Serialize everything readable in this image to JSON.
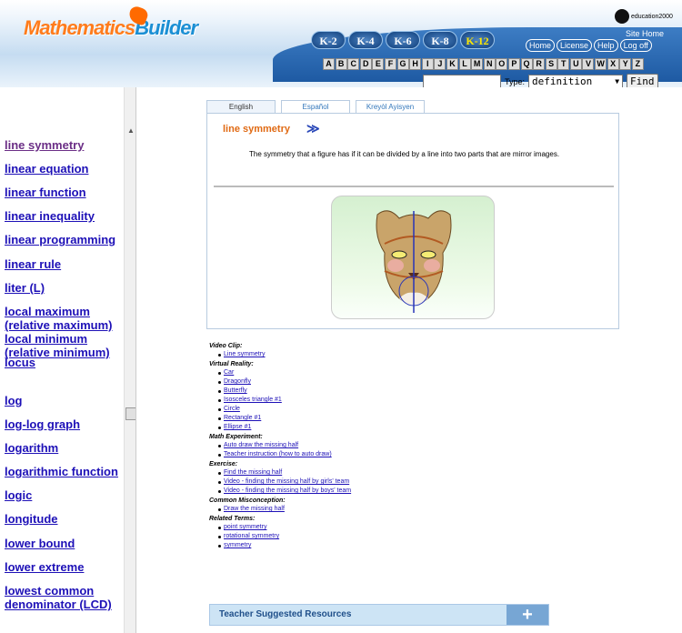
{
  "header": {
    "logo_left": "Mathematics",
    "logo_right": "Builder",
    "grades": [
      "K-2",
      "K-4",
      "K-6",
      "K-8",
      "K-12"
    ],
    "active_grade": "K-12",
    "brand": "education2000",
    "site_home": "Site Home",
    "top_links": [
      "Home",
      "License",
      "Help",
      "Log off"
    ]
  },
  "alphabet": [
    "A",
    "B",
    "C",
    "D",
    "E",
    "F",
    "G",
    "H",
    "I",
    "J",
    "K",
    "L",
    "M",
    "N",
    "O",
    "P",
    "Q",
    "R",
    "S",
    "T",
    "U",
    "V",
    "W",
    "X",
    "Y",
    "Z"
  ],
  "search": {
    "value": "",
    "type_label": "Type:",
    "type_value": "definition",
    "find_label": "Find"
  },
  "terms": [
    "line symmetry",
    "linear equation",
    "linear function",
    "linear inequality",
    "linear programming",
    "linear rule",
    "liter (L)",
    "local maximum (relative maximum)",
    "local minimum (relative minimum)",
    "locus",
    "log",
    "log-log graph",
    "logarithm",
    "logarithmic function",
    "logic",
    "longitude",
    "lower bound",
    "lower extreme",
    "lowest common denominator (LCD)"
  ],
  "tabs": [
    "English",
    "Español",
    "Kreyòl Ayisyen"
  ],
  "entry": {
    "title": "line symmetry",
    "arrow": "≫",
    "definition": "The symmetry that a figure has if it can be divided by a line into two parts that are mirror images."
  },
  "sections": [
    {
      "title": "Video Clip:",
      "items": [
        "Line symmetry"
      ]
    },
    {
      "title": "Virtual Reality:",
      "items": [
        "Car",
        "Dragonfly",
        "Butterfly",
        "Isosceles triangle #1",
        "Circle",
        "Rectangle #1",
        "Ellipse #1"
      ]
    },
    {
      "title": "Math Experiment:",
      "items": [
        "Auto draw the missing half",
        "Teacher instruction (how to auto draw)"
      ]
    },
    {
      "title": "Exercise:",
      "items": [
        "Find the missing half",
        "Video - finding the missing half by girls' team",
        "Video - finding the missing half by boys' team"
      ]
    },
    {
      "title": "Common Misconception:",
      "items": [
        "Draw the missing half"
      ]
    },
    {
      "title": "Related Terms:",
      "items": [
        "point symmetry",
        "rotational symmetry",
        "symmetry"
      ]
    }
  ],
  "teacher": {
    "label": "Teacher Suggested Resources",
    "plus": "+"
  }
}
